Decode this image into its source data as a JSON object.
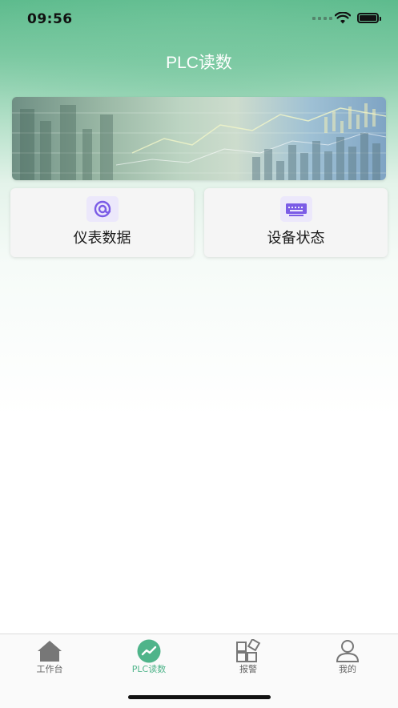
{
  "status_bar": {
    "time": "09:56"
  },
  "header": {
    "title": "PLC读数"
  },
  "cards": [
    {
      "label": "仪表数据",
      "icon": "meter-icon"
    },
    {
      "label": "设备状态",
      "icon": "device-icon"
    }
  ],
  "tabbar": {
    "items": [
      {
        "label": "工作台",
        "icon": "home-icon",
        "active": false
      },
      {
        "label": "PLC读数",
        "icon": "chart-line-icon",
        "active": true
      },
      {
        "label": "报警",
        "icon": "grid-apps-icon",
        "active": false
      },
      {
        "label": "我的",
        "icon": "user-icon",
        "active": false
      }
    ]
  },
  "colors": {
    "accent": "#4fb48a",
    "icon_purple": "#7b5ce6",
    "header_green": "#5dbb8d"
  }
}
